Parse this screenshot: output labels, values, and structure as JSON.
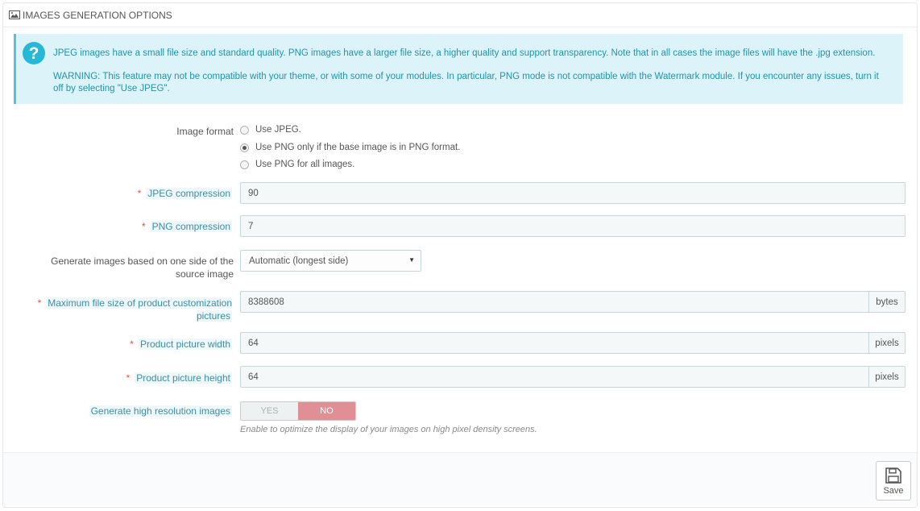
{
  "panel": {
    "title": "IMAGES GENERATION OPTIONS",
    "title_icon": "image-icon"
  },
  "alert": {
    "icon": "question-icon",
    "icon_glyph": "?",
    "text1": "JPEG images have a small file size and standard quality. PNG images have a larger file size, a higher quality and support transparency. Note that in all cases the image files will have the .jpg extension.",
    "text2": "WARNING: This feature may not be compatible with your theme, or with some of your modules. In particular, PNG mode is not compatible with the Watermark module. If you encounter any issues, turn it off by selecting \"Use JPEG\"."
  },
  "image_format": {
    "label": "Image format",
    "options": [
      {
        "label": "Use JPEG.",
        "checked": false
      },
      {
        "label": "Use PNG only if the base image is in PNG format.",
        "checked": true
      },
      {
        "label": "Use PNG for all images.",
        "checked": false
      }
    ]
  },
  "jpeg_compression": {
    "required": "*",
    "label": "JPEG compression",
    "value": "90"
  },
  "png_compression": {
    "required": "*",
    "label": "PNG compression",
    "value": "7"
  },
  "generate_side": {
    "label": "Generate images based on one side of the source image",
    "selected": "Automatic (longest side)"
  },
  "max_file_size": {
    "required": "*",
    "label": "Maximum file size of product customization pictures",
    "value": "8388608",
    "unit": "bytes"
  },
  "picture_width": {
    "required": "*",
    "label": "Product picture width",
    "value": "64",
    "unit": "pixels"
  },
  "picture_height": {
    "required": "*",
    "label": "Product picture height",
    "value": "64",
    "unit": "pixels"
  },
  "high_res": {
    "label": "Generate high resolution images",
    "yes": "YES",
    "no": "NO",
    "selected": "NO",
    "help": "Enable to optimize the display of your images on high pixel density screens."
  },
  "footer": {
    "save_label": "Save",
    "save_icon": "save-icon"
  },
  "colors": {
    "alert_bg": "#dcf4f9",
    "alert_text": "#1e94ab",
    "required": "#e3504f",
    "switch_no": "#e08f95"
  }
}
